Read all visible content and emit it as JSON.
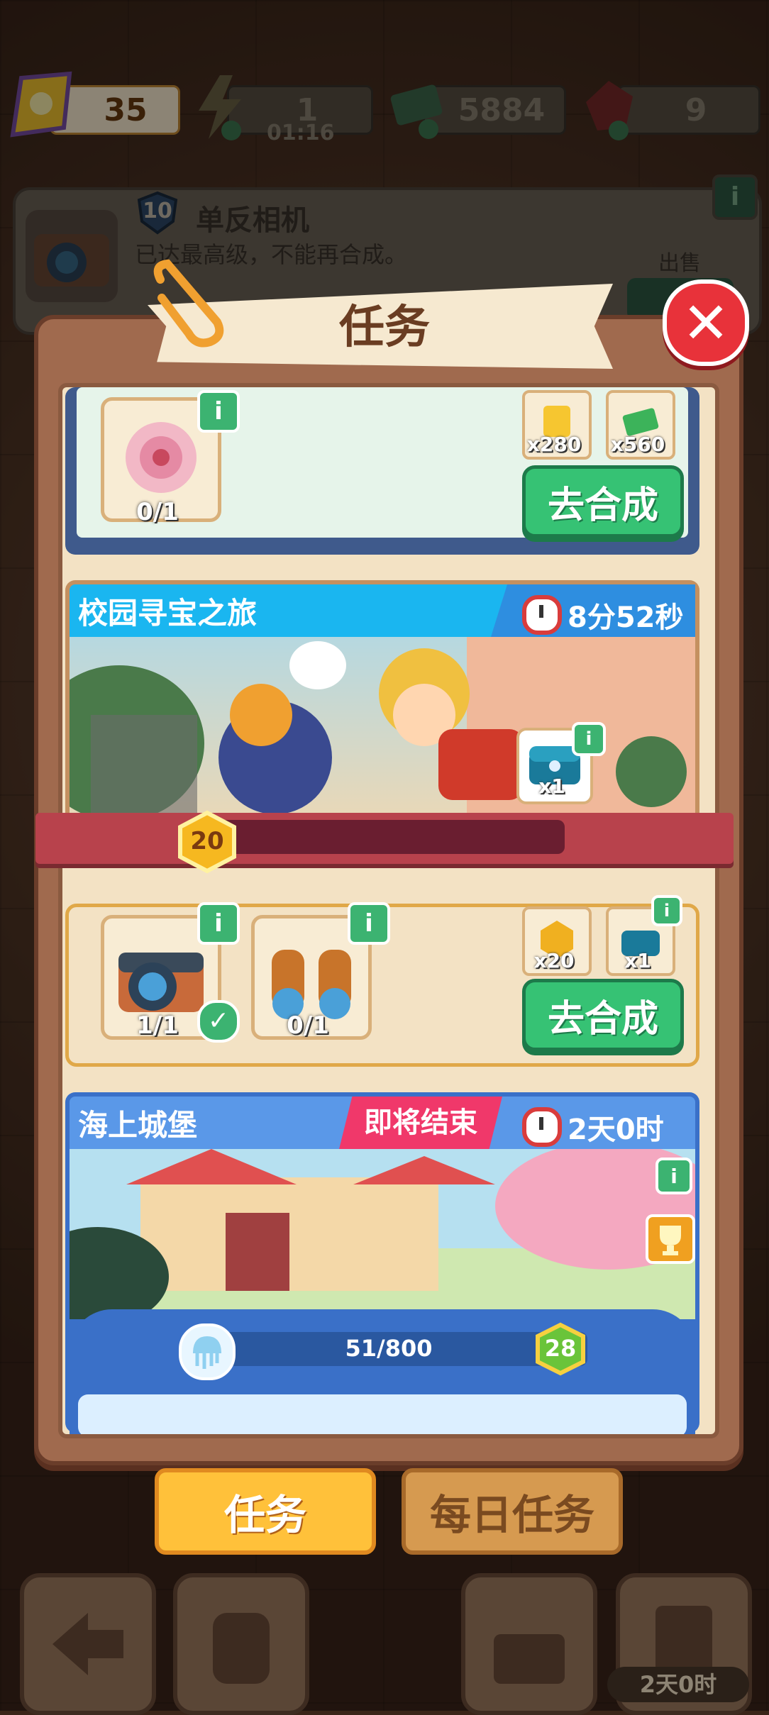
{
  "header": {
    "tickets": "35",
    "energy": "1",
    "energy_timer": "01:16",
    "cash": "5884",
    "gems": "9"
  },
  "selected_item": {
    "level": "10",
    "name": "单反相机",
    "description": "已达最高级，不能再合成。",
    "sell_label": "出售"
  },
  "modal": {
    "title": "任务",
    "close": "✕"
  },
  "task1": {
    "item_count": "0/1",
    "reward1": "x280",
    "reward2": "x560",
    "button": "去合成"
  },
  "task2": {
    "title": "校园寻宝之旅",
    "timer": "8分52秒",
    "chest_reward": "x1",
    "level": "20",
    "progress": 0.0,
    "item1_count": "1/1",
    "item2_count": "0/1",
    "reward1": "x20",
    "reward2": "x1",
    "button": "去合成"
  },
  "event": {
    "title": "海上城堡",
    "ending_tag": "即将结束",
    "timer": "2天0时",
    "progress_text": "51/800",
    "progress": 0.06375,
    "level": "28"
  },
  "tabs": {
    "tasks": "任务",
    "daily": "每日任务"
  },
  "bottom": {
    "timer": "2天0时"
  },
  "info_icon": "i"
}
